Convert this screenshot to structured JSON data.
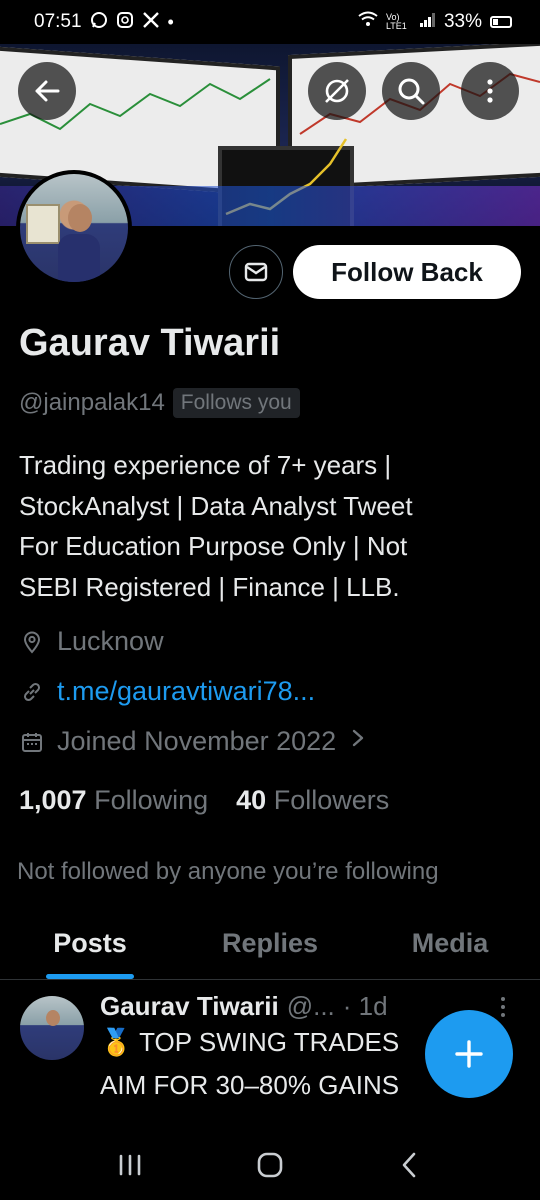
{
  "status_bar": {
    "time": "07:51",
    "notification_icons": [
      "whatsapp-icon",
      "instagram-threads-icon",
      "x-icon",
      "dot-icon"
    ],
    "signal_text": "Vo) LTE1",
    "battery": "33%"
  },
  "header": {
    "back_icon": "arrow-left-icon",
    "grok_icon": "grok-icon",
    "search_icon": "search-icon",
    "more_icon": "more-vertical-icon"
  },
  "profile": {
    "name": "Gaurav Tiwarii",
    "handle": "@jainpalak14",
    "follows_you_badge": "Follows you",
    "bio_lines": [
      "Trading experience of 7+ years |",
      "StockAnalyst | Data Analyst Tweet",
      "For Education Purpose Only | Not",
      "SEBI Registered | Finance | LLB."
    ],
    "location": "Lucknow",
    "link": "t.me/gauravtiwari78...",
    "joined": "Joined November 2022",
    "following_count": "1,007",
    "following_label": "Following",
    "followers_count": "40",
    "followers_label": "Followers",
    "not_followed_text": "Not followed by anyone you’re following"
  },
  "actions": {
    "message_icon": "envelope-icon",
    "follow_back_label": "Follow Back"
  },
  "tabs": [
    {
      "label": "Posts",
      "active": true
    },
    {
      "label": "Replies",
      "active": false
    },
    {
      "label": "Media",
      "active": false
    }
  ],
  "post": {
    "author": "Gaurav Tiwarii",
    "handle_truncated": "@...",
    "time": "· 1d",
    "line1": "🥇 TOP SWING TRADES",
    "line2": "AIM FOR 30–80% GAINS"
  },
  "fab": {
    "icon": "plus-icon"
  },
  "nav": {
    "items": [
      "recent-apps-icon",
      "home-icon",
      "back-icon"
    ]
  },
  "colors": {
    "accent": "#1d9bf0",
    "muted": "#71767b",
    "text": "#e7e9ea",
    "background": "#000000"
  }
}
